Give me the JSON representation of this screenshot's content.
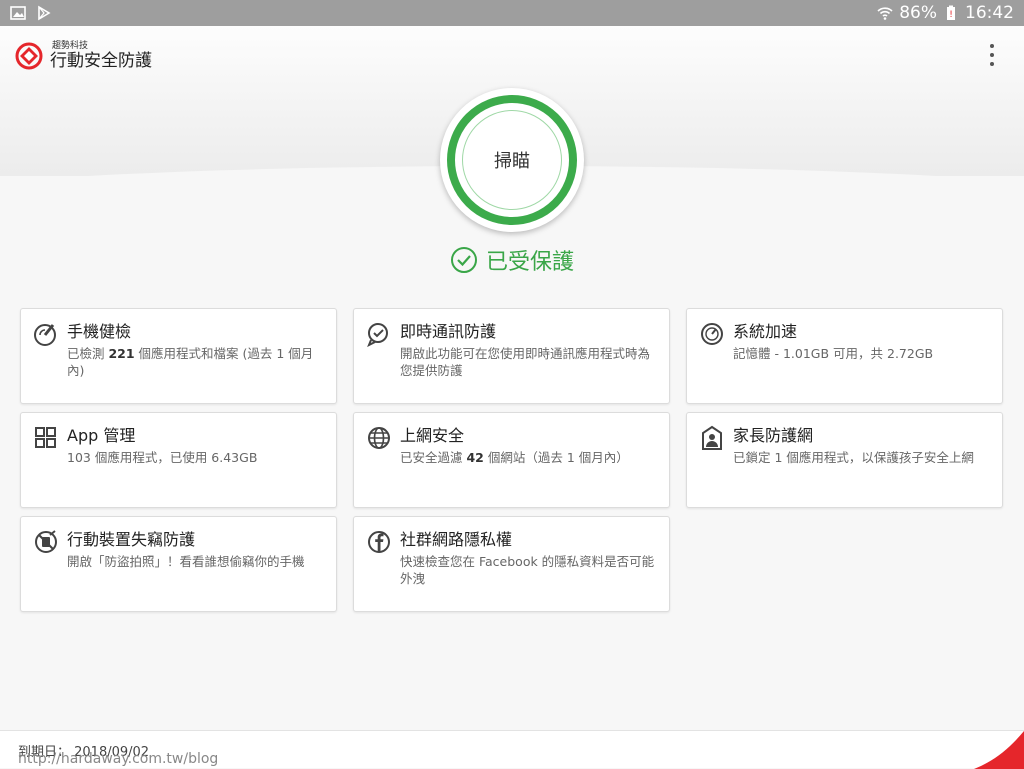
{
  "status": {
    "battery": "86%",
    "time": "16:42"
  },
  "app": {
    "company": "趨勢科技",
    "name": "行動安全防護"
  },
  "scan": {
    "label": "掃瞄"
  },
  "state": {
    "text": "已受保護"
  },
  "cards": [
    {
      "title": "手機健檢",
      "desc_parts": [
        "已檢測 ",
        "221",
        " 個應用程式和檔案 (過去 1 個月內)"
      ]
    },
    {
      "title": "即時通訊防護",
      "desc": "開啟此功能可在您使用即時通訊應用程式時為您提供防護"
    },
    {
      "title": "系統加速",
      "desc": "記憶體 - 1.01GB 可用，共 2.72GB"
    },
    {
      "title": "App 管理",
      "desc": "103 個應用程式，已使用 6.43GB"
    },
    {
      "title": "上網安全",
      "desc_parts": [
        "已安全過濾 ",
        "42",
        " 個網站（過去 1 個月內）"
      ]
    },
    {
      "title": "家長防護網",
      "desc": "已鎖定 1 個應用程式，以保護孩子安全上網"
    },
    {
      "title": "行動裝置失竊防護",
      "desc": "開啟「防盜拍照」！看看誰想偷竊你的手機"
    },
    {
      "title": "社群網路隱私權",
      "desc": "快速檢查您在 Facebook 的隱私資料是否可能外洩"
    }
  ],
  "footer": {
    "expiry": "到期日： 2018/09/02",
    "watermark": "http://hardaway.com.tw/blog"
  },
  "colors": {
    "accent": "#3cab4b",
    "brand": "#e5262b"
  }
}
